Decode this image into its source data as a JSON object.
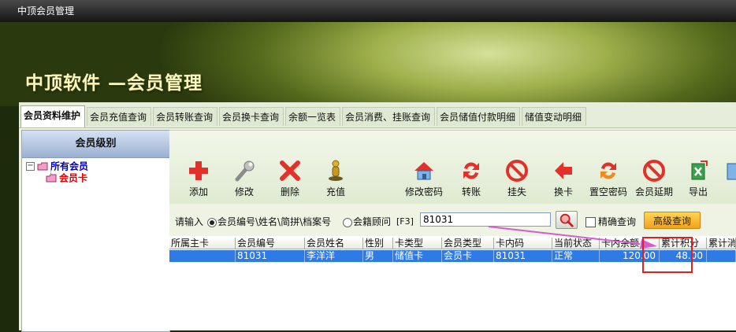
{
  "window": {
    "title": "中顶会员管理"
  },
  "banner": {
    "title": "中顶软件 —会员管理"
  },
  "tabs": [
    {
      "label": "会员资料维护",
      "active": true
    },
    {
      "label": "会员充值查询"
    },
    {
      "label": "会员转账查询"
    },
    {
      "label": "会员换卡查询"
    },
    {
      "label": "余额一览表"
    },
    {
      "label": "会员消费、挂账查询"
    },
    {
      "label": "会员储值付款明细"
    },
    {
      "label": "储值变动明细"
    }
  ],
  "sidebar": {
    "header": "会员级别",
    "tree": {
      "root": "所有会员",
      "child": "会员卡"
    }
  },
  "toolbar": {
    "buttons": [
      {
        "label": "添加",
        "icon": "plus-icon"
      },
      {
        "label": "修改",
        "icon": "wrench-icon"
      },
      {
        "label": "删除",
        "icon": "delete-x-icon"
      },
      {
        "label": "充值",
        "icon": "recharge-icon"
      },
      {
        "label": "修改密码",
        "icon": "house-icon"
      },
      {
        "label": "转账",
        "icon": "transfer-icon"
      },
      {
        "label": "挂失",
        "icon": "no-entry-icon"
      },
      {
        "label": "换卡",
        "icon": "exchange-icon"
      },
      {
        "label": "置空密码",
        "icon": "reset-icon"
      },
      {
        "label": "会员延期",
        "icon": "no-entry-icon"
      },
      {
        "label": "导出",
        "icon": "export-icon"
      }
    ]
  },
  "search": {
    "prompt": "请输入",
    "option1": "会员编号\\姓名\\简拼\\档案号",
    "option2": "会籍顾问",
    "hotkey": "[F3]",
    "value": "81031",
    "exact_label": "精确查询",
    "advanced_label": "高级查询"
  },
  "grid": {
    "columns": [
      "所属主卡",
      "会员编号",
      "会员姓名",
      "性别",
      "卡类型",
      "会员类型",
      "卡内码",
      "当前状态",
      "卡内余额",
      "累计积分",
      "累计消"
    ],
    "rows": [
      [
        "",
        "81031",
        "李洋洋",
        "男",
        "储值卡",
        "会员卡",
        "81031",
        "正常",
        "120.00",
        "48.00",
        ""
      ]
    ]
  },
  "colors": {
    "accent": "#2f7ae5",
    "annotation": "#e02020",
    "arrow": "#d65ad0"
  }
}
